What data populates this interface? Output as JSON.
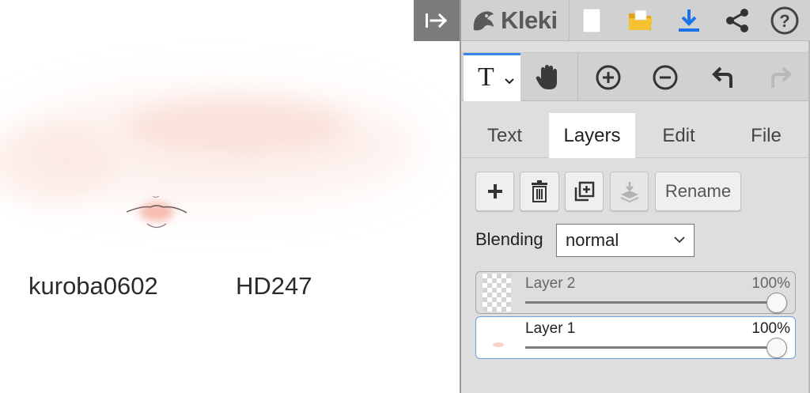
{
  "canvas": {
    "texts": [
      "kuroba0602",
      "HD247"
    ]
  },
  "app": {
    "logo_text": "Kleki"
  },
  "toolbar": {
    "tools": [
      {
        "name": "text-tool",
        "label": "T",
        "active": true
      },
      {
        "name": "hand-tool",
        "icon": "hand-icon"
      },
      {
        "name": "zoom-in",
        "icon": "zoom-in-icon"
      },
      {
        "name": "zoom-out",
        "icon": "zoom-out-icon"
      },
      {
        "name": "undo",
        "icon": "undo-icon"
      },
      {
        "name": "redo",
        "icon": "redo-icon",
        "disabled": true
      }
    ]
  },
  "tabs": [
    {
      "label": "Text",
      "active": false
    },
    {
      "label": "Layers",
      "active": true
    },
    {
      "label": "Edit",
      "active": false
    },
    {
      "label": "File",
      "active": false
    }
  ],
  "layer_buttons": {
    "rename_label": "Rename"
  },
  "blending": {
    "label": "Blending",
    "value": "normal"
  },
  "layers": [
    {
      "name": "Layer 2",
      "opacity_label": "100%",
      "opacity": 1.0,
      "selected": false
    },
    {
      "name": "Layer 1",
      "opacity_label": "100%",
      "opacity": 1.0,
      "selected": true
    }
  ],
  "colors": {
    "accent": "#3b83e6",
    "download_icon": "#1a73e8",
    "folder_icon": "#f2b51c",
    "sidebar_bg": "#dedede"
  }
}
